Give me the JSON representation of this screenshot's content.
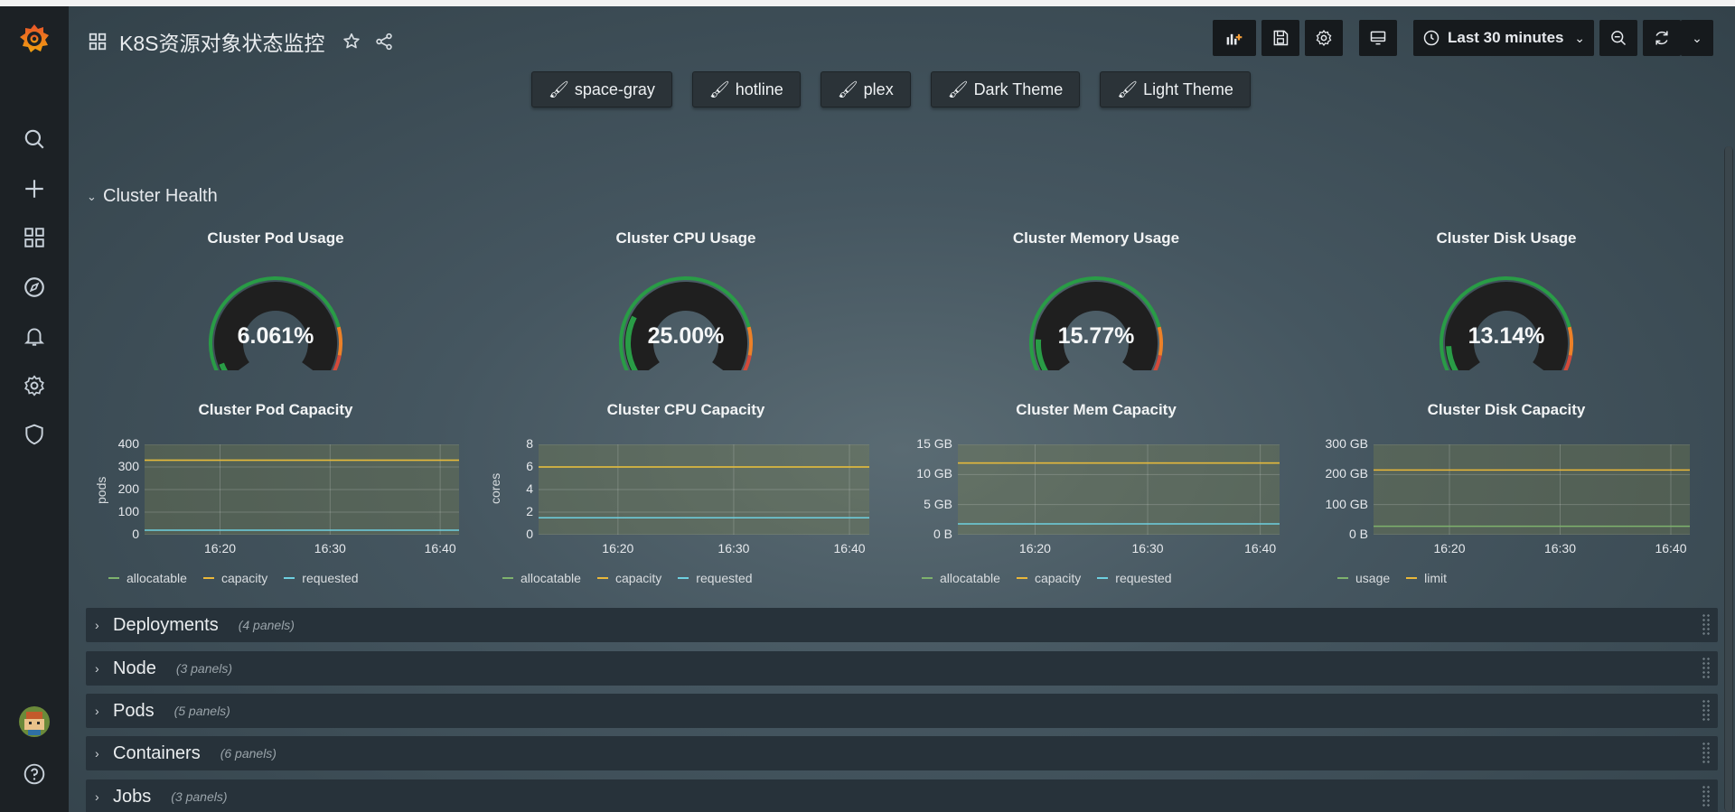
{
  "dashboard": {
    "title": "K8S资源对象状态监控"
  },
  "toolbar": {
    "time_range": "Last 30 minutes"
  },
  "themes": [
    {
      "label": "space-gray"
    },
    {
      "label": "hotline"
    },
    {
      "label": "plex"
    },
    {
      "label": "Dark Theme"
    },
    {
      "label": "Light Theme"
    }
  ],
  "cluster_health": {
    "title": "Cluster Health",
    "gauges": [
      {
        "title": "Cluster Pod Usage",
        "value": "6.061%",
        "fraction": 0.0606
      },
      {
        "title": "Cluster CPU Usage",
        "value": "25.00%",
        "fraction": 0.25
      },
      {
        "title": "Cluster Memory Usage",
        "value": "15.77%",
        "fraction": 0.1577
      },
      {
        "title": "Cluster Disk Usage",
        "value": "13.14%",
        "fraction": 0.1314
      }
    ]
  },
  "chart_data": [
    {
      "type": "line",
      "title": "Cluster Pod Capacity",
      "ylabel": "pods",
      "yticks": [
        "400",
        "300",
        "200",
        "100",
        "0"
      ],
      "xticks": [
        "16:20",
        "16:30",
        "16:40"
      ],
      "ylim": [
        0,
        400
      ],
      "series": [
        {
          "name": "allocatable",
          "color": "#7eb26d",
          "values": [
            330,
            330
          ]
        },
        {
          "name": "capacity",
          "color": "#eab839",
          "values": [
            330,
            330
          ]
        },
        {
          "name": "requested",
          "color": "#6ed0e0",
          "values": [
            20,
            20
          ]
        }
      ]
    },
    {
      "type": "line",
      "title": "Cluster CPU Capacity",
      "ylabel": "cores",
      "yticks": [
        "8",
        "6",
        "4",
        "2",
        "0"
      ],
      "xticks": [
        "16:20",
        "16:30",
        "16:40"
      ],
      "ylim": [
        0,
        8
      ],
      "series": [
        {
          "name": "allocatable",
          "color": "#7eb26d",
          "values": [
            6,
            6
          ]
        },
        {
          "name": "capacity",
          "color": "#eab839",
          "values": [
            6,
            6
          ]
        },
        {
          "name": "requested",
          "color": "#6ed0e0",
          "values": [
            1.5,
            1.5
          ]
        }
      ]
    },
    {
      "type": "line",
      "title": "Cluster Mem Capacity",
      "ylabel": "",
      "yticks": [
        "15 GB",
        "10 GB",
        "5 GB",
        "0 B"
      ],
      "xticks": [
        "16:20",
        "16:30",
        "16:40"
      ],
      "ylim": [
        0,
        15
      ],
      "series": [
        {
          "name": "allocatable",
          "color": "#7eb26d",
          "values": [
            11.9,
            11.9
          ]
        },
        {
          "name": "capacity",
          "color": "#eab839",
          "values": [
            11.9,
            11.9
          ]
        },
        {
          "name": "requested",
          "color": "#6ed0e0",
          "values": [
            1.8,
            1.8
          ]
        }
      ]
    },
    {
      "type": "line",
      "title": "Cluster Disk Capacity",
      "ylabel": "",
      "yticks": [
        "300 GB",
        "200 GB",
        "100 GB",
        "0 B"
      ],
      "xticks": [
        "16:20",
        "16:30",
        "16:40"
      ],
      "ylim": [
        0,
        300
      ],
      "series": [
        {
          "name": "usage",
          "color": "#7eb26d",
          "values": [
            28,
            28
          ]
        },
        {
          "name": "limit",
          "color": "#eab839",
          "values": [
            215,
            215
          ]
        }
      ]
    }
  ],
  "rows": [
    {
      "title": "Deployments",
      "panels": "(4 panels)"
    },
    {
      "title": "Node",
      "panels": "(3 panels)"
    },
    {
      "title": "Pods",
      "panels": "(5 panels)"
    },
    {
      "title": "Containers",
      "panels": "(6 panels)"
    },
    {
      "title": "Jobs",
      "panels": "(3 panels)"
    }
  ]
}
